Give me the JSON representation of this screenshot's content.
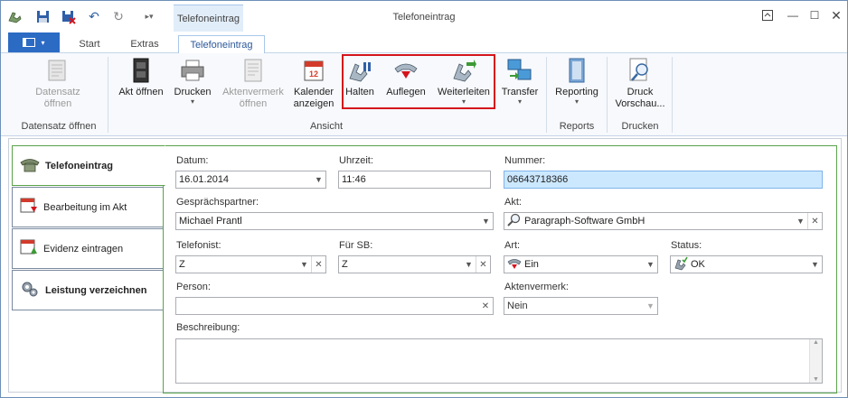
{
  "window": {
    "title": "Telefoneintrag",
    "context_tab": "Telefoneintrag"
  },
  "tabs": {
    "start": "Start",
    "extras": "Extras",
    "telefoneintrag": "Telefoneintrag"
  },
  "ribbon": {
    "datensatz": "Datensatz öffnen",
    "akt_oeffnen": "Akt öffnen",
    "drucken": "Drucken",
    "aktenvermerk": "Aktenvermerk öffnen",
    "kalender": "Kalender anzeigen",
    "halten": "Halten",
    "auflegen": "Auflegen",
    "weiterleiten": "Weiterleiten",
    "transfer": "Transfer",
    "reporting": "Reporting",
    "druckvorschau": "Druck Vorschau...",
    "groups": {
      "datensatz": "Datensatz öffnen",
      "ansicht": "Ansicht",
      "reports": "Reports",
      "drucken": "Drucken"
    }
  },
  "sidebar": {
    "items": [
      {
        "label": "Telefoneintrag"
      },
      {
        "label": "Bearbeitung im Akt"
      },
      {
        "label": "Evidenz eintragen"
      },
      {
        "label": "Leistung verzeichnen"
      }
    ]
  },
  "form": {
    "datum_label": "Datum:",
    "datum": "16.01.2014",
    "uhrzeit_label": "Uhrzeit:",
    "uhrzeit": "11:46",
    "nummer_label": "Nummer:",
    "nummer": "06643718366",
    "gespraechspartner_label": "Gesprächspartner:",
    "gespraechspartner": "Michael Prantl",
    "akt_label": "Akt:",
    "akt": "Paragraph-Software GmbH",
    "telefonist_label": "Telefonist:",
    "telefonist": "Z",
    "fuer_sb_label": "Für SB:",
    "fuer_sb": "Z",
    "art_label": "Art:",
    "art": "Ein",
    "status_label": "Status:",
    "status": "OK",
    "person_label": "Person:",
    "person": "",
    "aktenvermerk_label": "Aktenvermerk:",
    "aktenvermerk": "Nein",
    "beschreibung_label": "Beschreibung:",
    "beschreibung": ""
  }
}
